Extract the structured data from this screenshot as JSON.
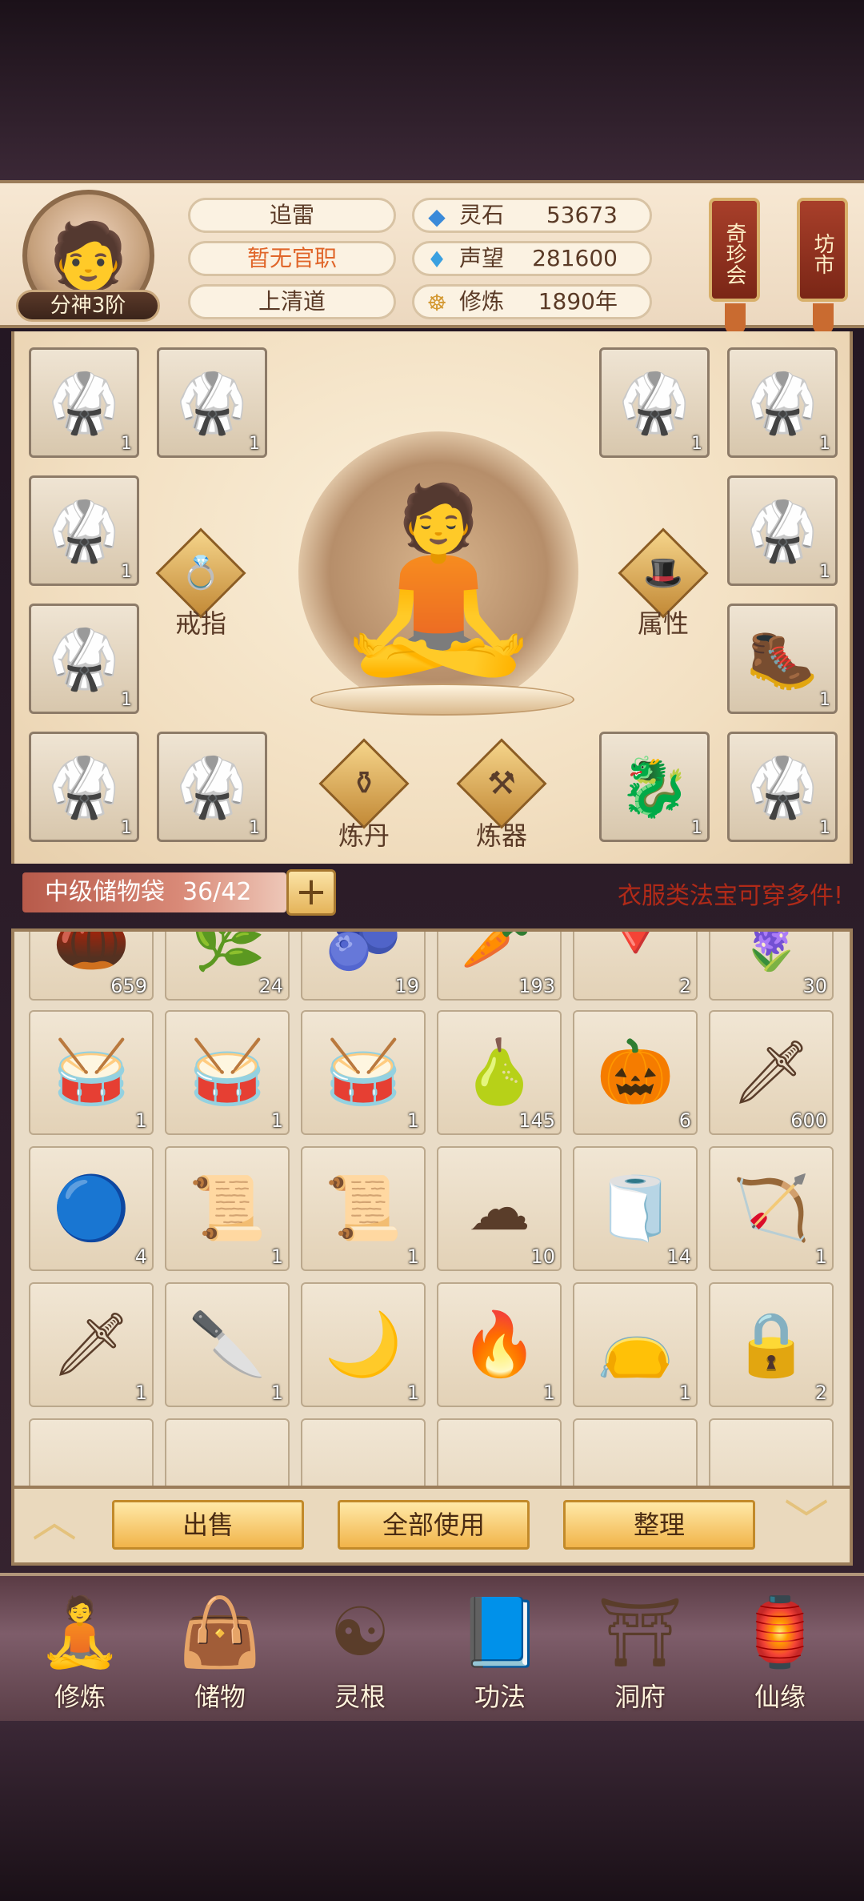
{
  "header": {
    "rank_badge": "分神3阶",
    "name": "追雷",
    "official_title": "暂无官职",
    "sect": "上清道",
    "stats": [
      {
        "label": "灵石",
        "value": "53673",
        "icon": "spirit-stone-icon"
      },
      {
        "label": "声望",
        "value": "281600",
        "icon": "reputation-icon"
      },
      {
        "label": "修炼",
        "value": "1890年",
        "icon": "cultivation-icon"
      }
    ],
    "side_tags": [
      "奇珍会",
      "坊市"
    ]
  },
  "equipment": {
    "slots": [
      {
        "count": "1",
        "icon": "robe-icon"
      },
      {
        "count": "1",
        "icon": "robe-icon"
      },
      {
        "count": "1",
        "icon": "robe-icon"
      },
      {
        "count": "1",
        "icon": "robe-icon"
      },
      {
        "count": "1",
        "icon": "robe-icon"
      },
      {
        "count": "1",
        "icon": "robe-icon"
      },
      {
        "count": "1",
        "icon": "robe-icon"
      },
      {
        "count": "1",
        "icon": "boots-icon"
      },
      {
        "count": "1",
        "icon": "robe-icon"
      },
      {
        "count": "1",
        "icon": "robe-icon"
      },
      {
        "count": "1",
        "icon": "dragon-icon"
      },
      {
        "count": "1",
        "icon": "robe-icon"
      }
    ],
    "functions": [
      {
        "label": "戒指",
        "icon": "ring-icon"
      },
      {
        "label": "属性",
        "icon": "attribute-icon"
      },
      {
        "label": "炼丹",
        "icon": "cauldron-icon"
      },
      {
        "label": "炼器",
        "icon": "anvil-icon"
      }
    ]
  },
  "bag": {
    "name": "中级储物袋",
    "capacity": "36/42",
    "hint": "衣服类法宝可穿多件!"
  },
  "inventory": [
    {
      "count": "659",
      "icon": "root-icon"
    },
    {
      "count": "24",
      "icon": "herb-icon"
    },
    {
      "count": "19",
      "icon": "berry-icon"
    },
    {
      "count": "193",
      "icon": "ginseng-icon"
    },
    {
      "count": "2",
      "icon": "crystal-icon"
    },
    {
      "count": "30",
      "icon": "flower-icon"
    },
    {
      "count": "1",
      "icon": "drum-icon"
    },
    {
      "count": "1",
      "icon": "drum-icon"
    },
    {
      "count": "1",
      "icon": "drum-icon"
    },
    {
      "count": "145",
      "icon": "gourd-green-icon"
    },
    {
      "count": "6",
      "icon": "gourd-orange-icon"
    },
    {
      "count": "600",
      "icon": "jade-sword-icon"
    },
    {
      "count": "4",
      "icon": "star-disk-icon"
    },
    {
      "count": "1",
      "icon": "scroll-green-icon"
    },
    {
      "count": "1",
      "icon": "scroll-green-icon"
    },
    {
      "count": "10",
      "icon": "cloud-talisman-icon"
    },
    {
      "count": "14",
      "icon": "paper-scroll-icon"
    },
    {
      "count": "1",
      "icon": "bow-icon"
    },
    {
      "count": "1",
      "icon": "blue-sword-icon"
    },
    {
      "count": "1",
      "icon": "red-dagger-icon"
    },
    {
      "count": "1",
      "icon": "curved-blade-icon"
    },
    {
      "count": "1",
      "icon": "flame-blade-icon"
    },
    {
      "count": "1",
      "icon": "pouch-icon"
    },
    {
      "count": "2",
      "icon": "locked-talisman-icon"
    }
  ],
  "actions": [
    "出售",
    "全部使用",
    "整理"
  ],
  "nav": [
    {
      "label": "修炼",
      "icon": "monk-icon"
    },
    {
      "label": "储物",
      "icon": "bag-icon"
    },
    {
      "label": "灵根",
      "icon": "spirit-root-icon"
    },
    {
      "label": "功法",
      "icon": "book-icon"
    },
    {
      "label": "洞府",
      "icon": "cave-house-icon"
    },
    {
      "label": "仙缘",
      "icon": "fortune-gourd-icon"
    }
  ],
  "colors": {
    "accent_gold": "#f1b44a",
    "hint_red": "#b12a18",
    "official_title": "#e0662a"
  }
}
